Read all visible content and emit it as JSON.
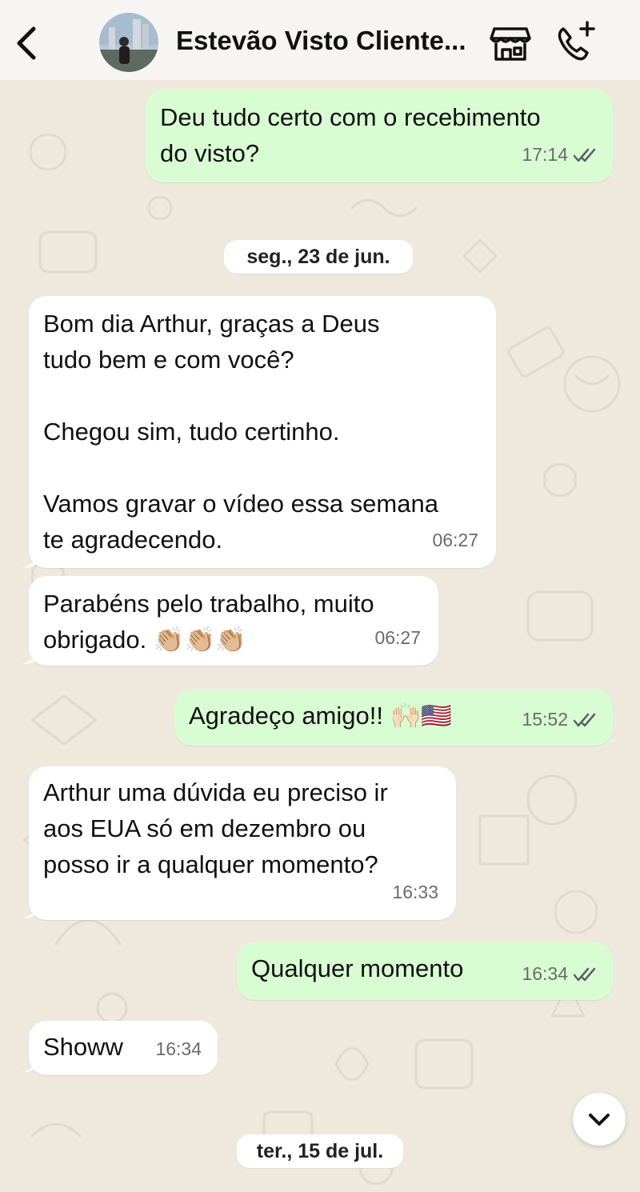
{
  "header": {
    "contact_name": "Estevão Visto Cliente...",
    "back_icon": "chevron-left-icon",
    "store_icon": "storefront-icon",
    "call_icon": "add-call-icon"
  },
  "colors": {
    "outgoing_bubble": "#d9fdd3",
    "incoming_bubble": "#ffffff",
    "wallpaper": "#efe8dd",
    "read_ticks": "#5c6166"
  },
  "messages": [
    {
      "direction": "out",
      "text": "Deu tudo certo com o recebimento\ndo visto?",
      "time": "17:14",
      "status": "read"
    },
    {
      "type": "date",
      "text": "seg., 23 de jun."
    },
    {
      "direction": "in",
      "text": "Bom dia Arthur, graças a Deus\ntudo bem e com você?\n\nChegou sim, tudo certinho.\n\nVamos gravar o vídeo essa semana\nte agradecendo.",
      "time": "06:27"
    },
    {
      "direction": "in",
      "text": "Parabéns pelo trabalho, muito\nobrigado. 👏🏼👏🏼👏🏼",
      "time": "06:27"
    },
    {
      "direction": "out",
      "text": "Agradeço amigo!! 🙌🏻🇺🇸",
      "time": "15:52",
      "status": "read"
    },
    {
      "direction": "in",
      "text": "Arthur uma dúvida eu preciso ir\naos EUA só em dezembro ou\nposso ir a qualquer momento?",
      "time": "16:33"
    },
    {
      "direction": "out",
      "text": "Qualquer momento",
      "time": "16:34",
      "status": "read"
    },
    {
      "direction": "in",
      "text": "Showw",
      "time": "16:34"
    },
    {
      "type": "date",
      "text": "ter., 15 de jul."
    }
  ],
  "scroll_button_icon": "chevron-down-icon"
}
